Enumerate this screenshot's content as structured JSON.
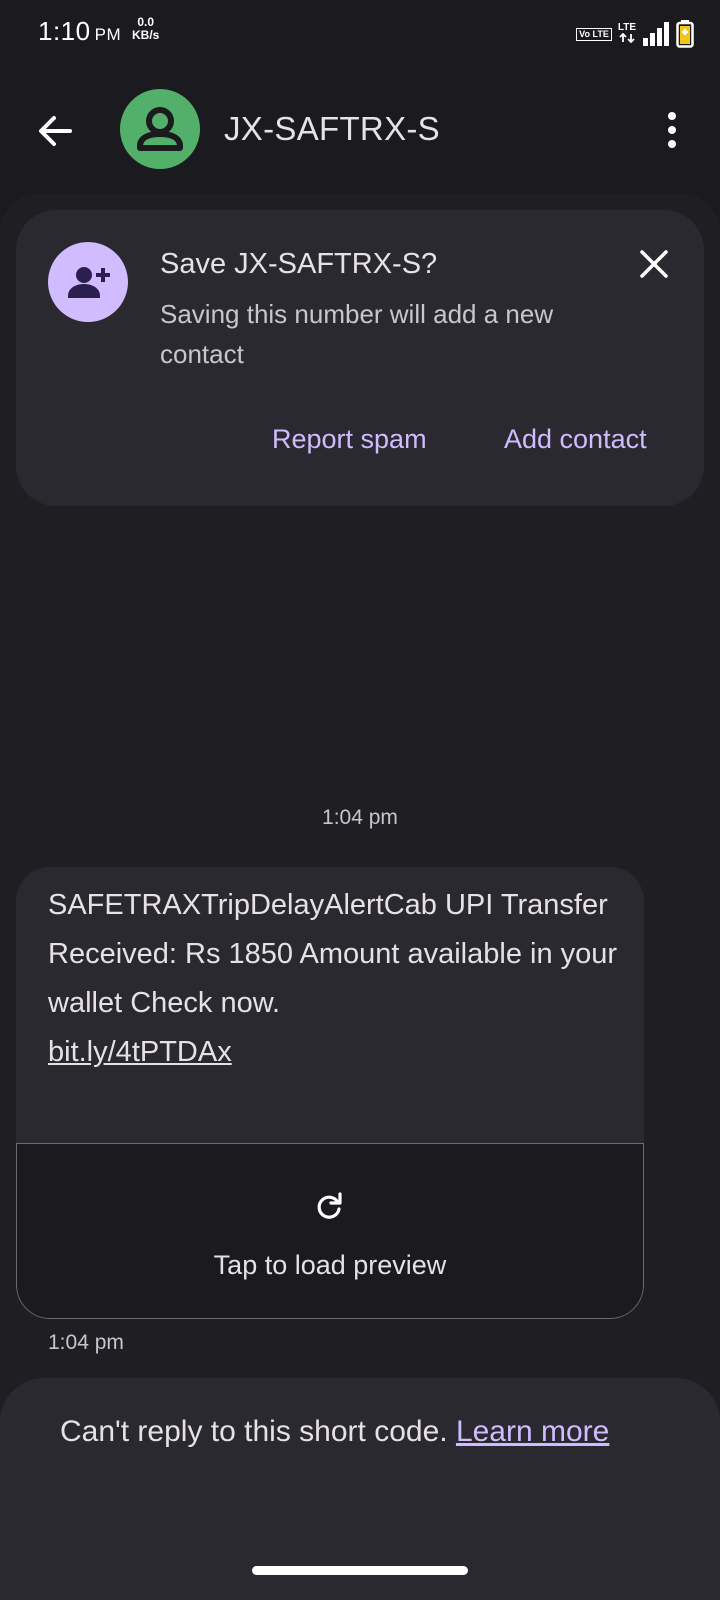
{
  "status_bar": {
    "time": "1:10",
    "ampm": "PM",
    "net_speed": "0.0",
    "net_unit": "KB/s",
    "volte_label": "Vo LTE",
    "lte_label": "LTE",
    "icons": [
      "volte-icon",
      "lte-icon",
      "signal-icon",
      "battery-charging-icon"
    ]
  },
  "app_bar": {
    "title": "JX-SAFTRX-S",
    "icons": [
      "back-arrow-icon",
      "person-icon",
      "more-vert-icon"
    ]
  },
  "save_card": {
    "title": "Save JX-SAFTRX-S?",
    "subtitle": "Saving this number will add a new contact",
    "report_spam_label": "Report spam",
    "add_contact_label": "Add contact",
    "icons": [
      "person-add-icon",
      "close-icon"
    ]
  },
  "conversation": {
    "header_timestamp": "1:04 pm",
    "message": {
      "text": "SAFETRAXTripDelayAlertCab UPI Transfer Received: Rs 1850 Amount available in your wallet Check now.",
      "link": "bit.ly/4tPTDAx",
      "preview_label": "Tap to load preview",
      "preview_icon": "refresh-icon",
      "timestamp": "1:04 pm"
    }
  },
  "reply_notice": {
    "text": "Can't reply to this short code.",
    "link": "Learn more"
  },
  "colors": {
    "background": "#1b1b1f",
    "surface": "#2a292f",
    "accent": "#cfbcff",
    "avatar_green": "#53b06a",
    "avatar_lavender": "#d0bcff"
  }
}
